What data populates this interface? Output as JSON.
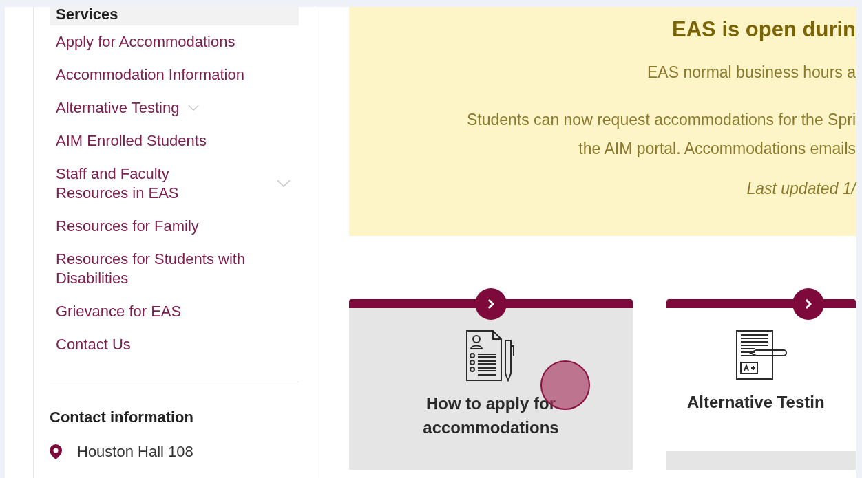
{
  "sidebar": {
    "section_title": "Services",
    "items": [
      {
        "label": "Apply for Accommodations",
        "has_submenu": false
      },
      {
        "label": "Accommodation Information",
        "has_submenu": false
      },
      {
        "label": "Alternative Testing",
        "has_submenu": true
      },
      {
        "label": "AIM Enrolled Students",
        "has_submenu": false
      },
      {
        "label": "Staff and Faculty Resources in EAS",
        "has_submenu": true
      },
      {
        "label": "Resources for Family",
        "has_submenu": false
      },
      {
        "label": "Resources for Students with Disabilities",
        "has_submenu": false
      },
      {
        "label": "Grievance for EAS",
        "has_submenu": false
      },
      {
        "label": "Contact Us",
        "has_submenu": false
      }
    ],
    "contact": {
      "title": "Contact information",
      "address": "Houston Hall 108"
    }
  },
  "notice": {
    "title": "EAS is open durin",
    "lines": [
      "EAS normal business hours a",
      "Students can now request accommodations for the Spri",
      "the AIM portal. Accommodations emails"
    ],
    "updated": "Last updated 1/"
  },
  "cards": [
    {
      "title": "How to apply for accommodations",
      "kind": "application",
      "hovered": true
    },
    {
      "title": "Alternative Testin",
      "kind": "test",
      "hovered": false
    }
  ]
}
